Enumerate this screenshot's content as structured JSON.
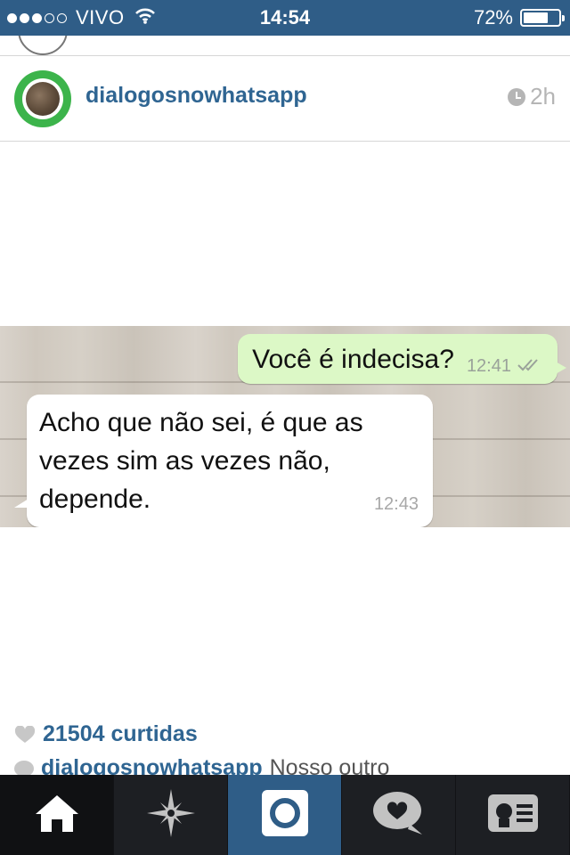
{
  "status_bar": {
    "signal_dots_filled": 3,
    "signal_dots_total": 5,
    "carrier": "VIVO",
    "time": "14:54",
    "battery_percent_text": "72%",
    "battery_level": 0.72
  },
  "post": {
    "username": "dialogosnowhatsapp",
    "time_ago": "2h"
  },
  "chat": {
    "outgoing": {
      "text": "Você é indecisa?",
      "time": "12:41"
    },
    "incoming": {
      "text": "Acho que não sei, é que as vezes sim as vezes não, depende.",
      "time": "12:43"
    }
  },
  "engagement": {
    "likes_text": "21504 curtidas",
    "caption_user": "dialogosnowhatsapp",
    "caption_text": "Nosso outro"
  },
  "tab_bar": {
    "tabs": [
      "home-icon",
      "explore-icon",
      "camera-icon",
      "news-icon",
      "profile-icon"
    ],
    "active_color": "#2f5d87"
  },
  "colors": {
    "brand_blue": "#2f5d87",
    "link_blue": "#2f6592",
    "whatsapp_green_bubble": "#dcf8c6"
  }
}
